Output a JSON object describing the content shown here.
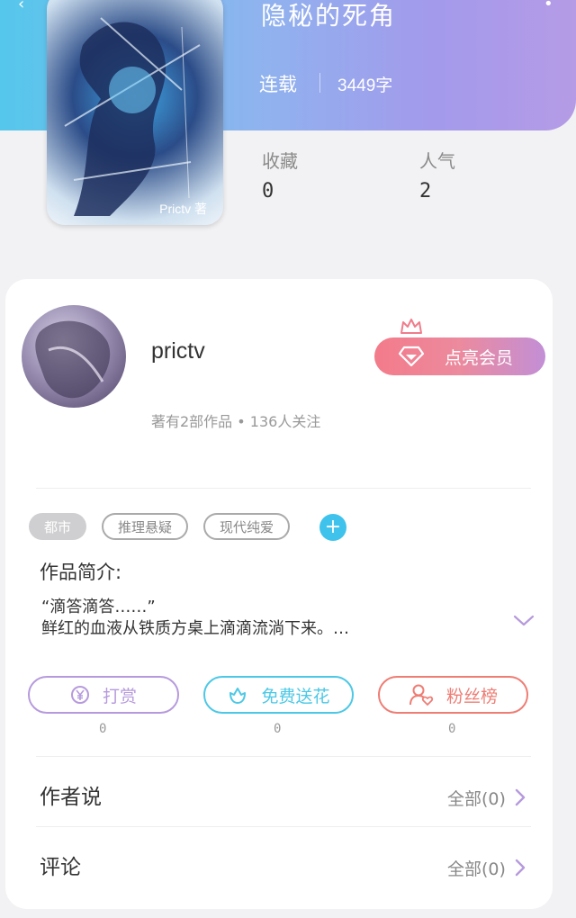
{
  "book": {
    "title": "隐秘的死角",
    "status": "连载",
    "word_count": "3449字",
    "cover_signature": "Prictv 著"
  },
  "stats": [
    {
      "label": "收藏",
      "value": "0"
    },
    {
      "label": "人气",
      "value": "2"
    }
  ],
  "author": {
    "name": "prictv",
    "meta": "著有2部作品 • 136人关注",
    "vip_button": "点亮会员"
  },
  "tags": [
    {
      "label": "都市",
      "style": "filled"
    },
    {
      "label": "推理悬疑",
      "style": "outline"
    },
    {
      "label": "现代纯爱",
      "style": "outline"
    }
  ],
  "intro": {
    "title": "作品简介:",
    "line1": "“滴答滴答……”",
    "line2": "鲜红的血液从铁质方桌上滴滴流淌下来。…"
  },
  "actions": [
    {
      "label": "打赏",
      "count": "0",
      "color": "#b69add",
      "icon": "yen-icon"
    },
    {
      "label": "免费送花",
      "count": "0",
      "color": "#4cc8e6",
      "icon": "flower-icon"
    },
    {
      "label": "粉丝榜",
      "count": "0",
      "color": "#ee7d74",
      "icon": "fan-rank-icon"
    }
  ],
  "sections": [
    {
      "title": "作者说",
      "right": "全部(0)"
    },
    {
      "title": "评论",
      "right": "全部(0)"
    }
  ],
  "colors": {
    "accent_purple": "#b69add",
    "accent_cyan": "#3fc3ec",
    "accent_red": "#ee7d74"
  }
}
